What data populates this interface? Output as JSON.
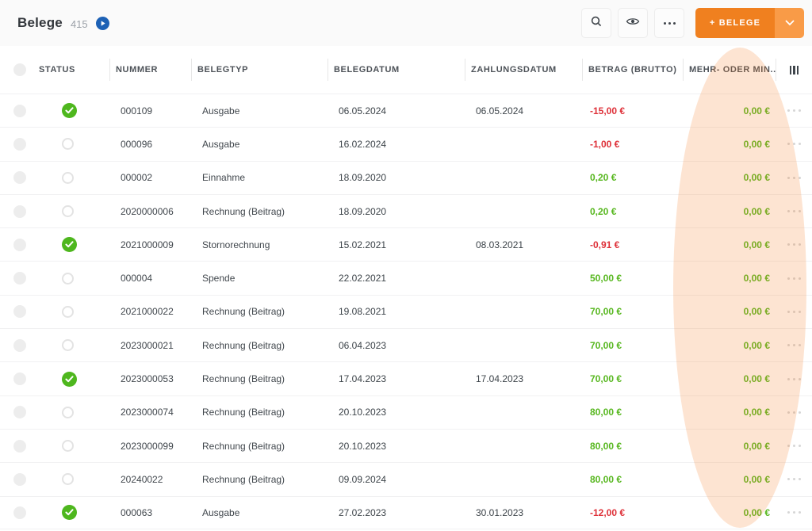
{
  "header": {
    "title": "Belege",
    "count": "415",
    "add_button_label": "+ BELEGE"
  },
  "table": {
    "columns": [
      "STATUS",
      "NUMMER",
      "BELEGTYP",
      "BELEGDATUM",
      "ZAHLUNGSDATUM",
      "BETRAG (BRUTTO)",
      "MEHR- ODER MIN..."
    ],
    "rows": [
      {
        "status": "checked",
        "nummer": "000109",
        "belegtyp": "Ausgabe",
        "belegdatum": "06.05.2024",
        "zahlungsdatum": "06.05.2024",
        "betrag": "-15,00 €",
        "mehr": "0,00 €"
      },
      {
        "status": "unchecked",
        "nummer": "000096",
        "belegtyp": "Ausgabe",
        "belegdatum": "16.02.2024",
        "zahlungsdatum": "",
        "betrag": "-1,00 €",
        "mehr": "0,00 €"
      },
      {
        "status": "unchecked",
        "nummer": "000002",
        "belegtyp": "Einnahme",
        "belegdatum": "18.09.2020",
        "zahlungsdatum": "",
        "betrag": "0,20 €",
        "mehr": "0,00 €"
      },
      {
        "status": "unchecked",
        "nummer": "2020000006",
        "belegtyp": "Rechnung (Beitrag)",
        "belegdatum": "18.09.2020",
        "zahlungsdatum": "",
        "betrag": "0,20 €",
        "mehr": "0,00 €"
      },
      {
        "status": "checked",
        "nummer": "2021000009",
        "belegtyp": "Stornorechnung",
        "belegdatum": "15.02.2021",
        "zahlungsdatum": "08.03.2021",
        "betrag": "-0,91 €",
        "mehr": "0,00 €"
      },
      {
        "status": "unchecked",
        "nummer": "000004",
        "belegtyp": "Spende",
        "belegdatum": "22.02.2021",
        "zahlungsdatum": "",
        "betrag": "50,00 €",
        "mehr": "0,00 €"
      },
      {
        "status": "unchecked",
        "nummer": "2021000022",
        "belegtyp": "Rechnung (Beitrag)",
        "belegdatum": "19.08.2021",
        "zahlungsdatum": "",
        "betrag": "70,00 €",
        "mehr": "0,00 €"
      },
      {
        "status": "unchecked",
        "nummer": "2023000021",
        "belegtyp": "Rechnung (Beitrag)",
        "belegdatum": "06.04.2023",
        "zahlungsdatum": "",
        "betrag": "70,00 €",
        "mehr": "0,00 €"
      },
      {
        "status": "checked",
        "nummer": "2023000053",
        "belegtyp": "Rechnung (Beitrag)",
        "belegdatum": "17.04.2023",
        "zahlungsdatum": "17.04.2023",
        "betrag": "70,00 €",
        "mehr": "0,00 €"
      },
      {
        "status": "unchecked",
        "nummer": "2023000074",
        "belegtyp": "Rechnung (Beitrag)",
        "belegdatum": "20.10.2023",
        "zahlungsdatum": "",
        "betrag": "80,00 €",
        "mehr": "0,00 €"
      },
      {
        "status": "unchecked",
        "nummer": "2023000099",
        "belegtyp": "Rechnung (Beitrag)",
        "belegdatum": "20.10.2023",
        "zahlungsdatum": "",
        "betrag": "80,00 €",
        "mehr": "0,00 €"
      },
      {
        "status": "unchecked",
        "nummer": "20240022",
        "belegtyp": "Rechnung (Beitrag)",
        "belegdatum": "09.09.2024",
        "zahlungsdatum": "",
        "betrag": "80,00 €",
        "mehr": "0,00 €"
      },
      {
        "status": "checked",
        "nummer": "000063",
        "belegtyp": "Ausgabe",
        "belegdatum": "27.02.2023",
        "zahlungsdatum": "30.01.2023",
        "betrag": "-12,00 €",
        "mehr": "0,00 €"
      }
    ]
  },
  "icons": {
    "play": "play-icon",
    "search": "search-icon",
    "eye": "eye-icon",
    "more": "ellipsis-icon",
    "caret": "chevron-down-icon",
    "columns": "column-settings-icon",
    "check": "check-icon",
    "row_menu": "row-ellipsis-icon"
  },
  "colors": {
    "accent_orange": "#F0801F",
    "accent_orange_light": "#F99B47",
    "positive_green": "#57B71F",
    "negative_red": "#DE3038",
    "badge_blue": "#1D61B5",
    "highlight_overlay": "rgba(244,126,42,0.21)",
    "topbar_bg": "#FAFAFA"
  }
}
